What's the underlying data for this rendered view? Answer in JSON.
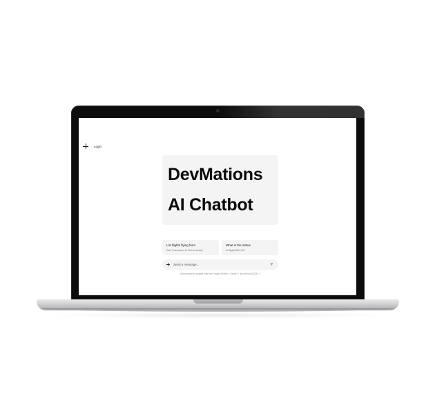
{
  "screen": {
    "header": {
      "new_chat_icon": "plus-icon",
      "login_label": "Login"
    },
    "hero": {
      "title_line1": "DevMations",
      "title_line2": "AI Chatbot"
    },
    "suggestions": [
      {
        "title": "List flights flying from",
        "subtitle": "San Francisco to Rome today"
      },
      {
        "title": "What is the status",
        "subtitle": "of flight BA142?"
      }
    ],
    "composer": {
      "attach_icon": "plus-icon",
      "placeholder": "Send a message...",
      "send_icon": "send-arrow-icon"
    },
    "footer_note": "Open source AI chatbot built with Google Gemini ↗ Vercel ↗ and Vercel AI SDK ↗"
  }
}
